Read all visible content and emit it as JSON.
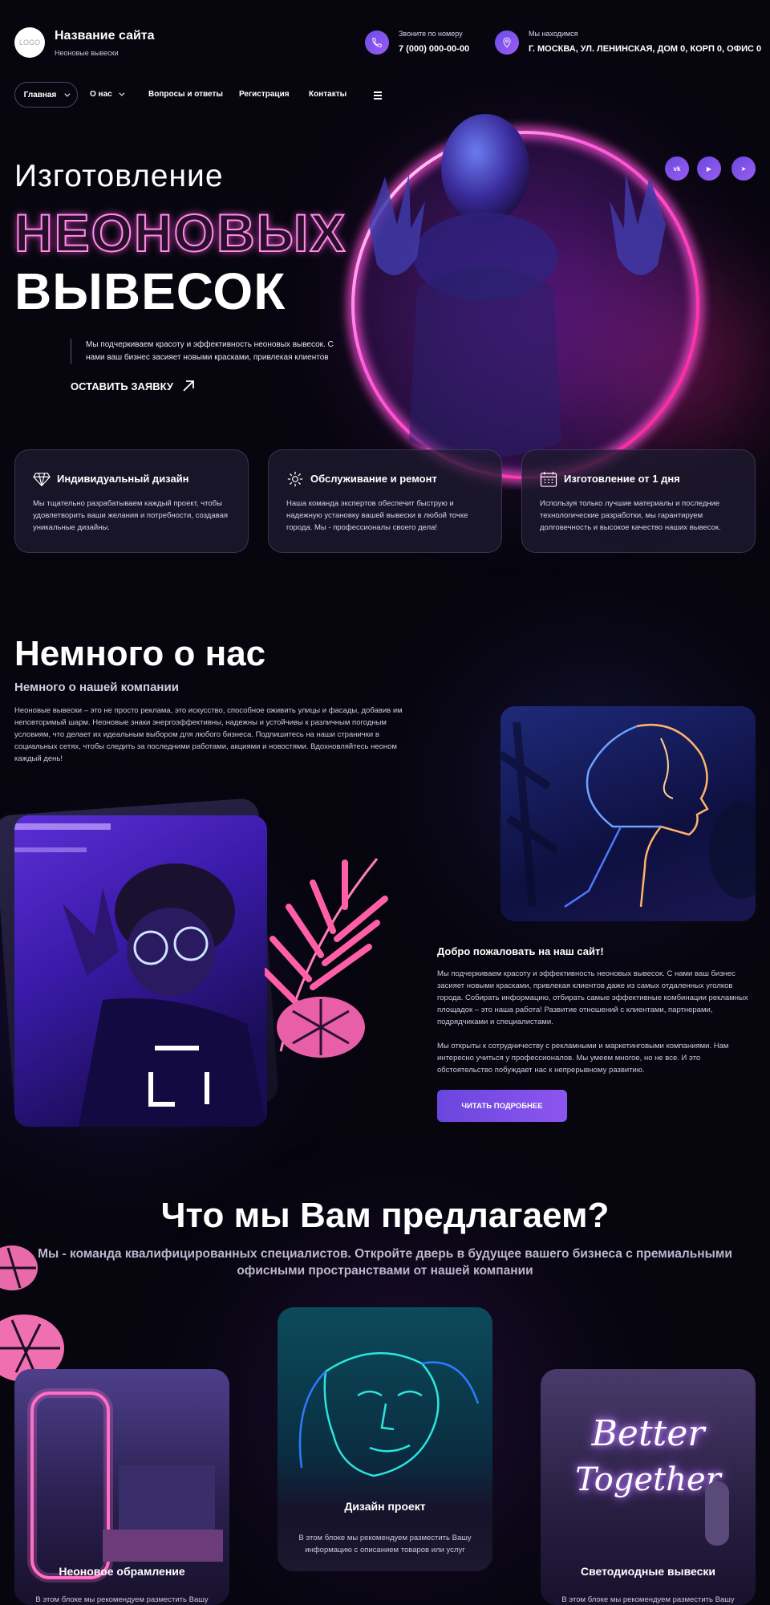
{
  "header": {
    "logo_text": "LOGO",
    "site_title": "Название сайта",
    "site_subtitle": "Неоновые вывески",
    "phone_label": "Звоните по номеру",
    "phone_value": "7 (000) 000-00-00",
    "address_label": "Мы находимся",
    "address_value": "Г. МОСКВА, УЛ. ЛЕНИНСКАЯ, ДОМ 0, КОРП 0, ОФИС 0"
  },
  "nav": {
    "items": [
      "Главная",
      "О нас",
      "Вопросы и ответы",
      "Регистрация",
      "Контакты"
    ]
  },
  "hero": {
    "line1": "Изготовление",
    "line2": "НЕОНОВЫХ",
    "line3": "ВЫВЕСОК",
    "description": "Мы подчеркиваем красоту и эффективность неоновых вывесок. С нами ваш бизнес засияет новыми красками, привлекая клиентов",
    "cta": "ОСТАВИТЬ ЗАЯВКУ"
  },
  "social": [
    "vk",
    "▶",
    "➤"
  ],
  "features": [
    {
      "title": "Индивидуальный дизайн",
      "text": "Мы тщательно разрабатываем каждый проект, чтобы удовлетворить ваши желания и потребности, создавая уникальные дизайны.",
      "icon": "diamond-icon"
    },
    {
      "title": "Обслуживание и ремонт",
      "text": "Наша команда экспертов обеспечит быструю и надежную установку вашей вывески в любой точке города. Мы - профессионалы своего дела!",
      "icon": "gear-icon"
    },
    {
      "title": "Изготовление от 1 дня",
      "text": "Используя только лучшие материалы и последние технологические разработки, мы гарантируем долговечность и высокое качество наших вывесок.",
      "icon": "calendar-icon"
    }
  ],
  "about": {
    "title": "Немного о нас",
    "subtitle": "Немного о нашей компании",
    "text": "Неоновые вывески – это не просто реклама, это искусство, способное оживить улицы и фасады, добавив им неповторимый шарм. Неоновые знаки энергоэффективны, надежны и устойчивы к различным погодным условиям, что делает их идеальным выбором для любого бизнеса. Подпишитесь на наши странички в социальных сетях, чтобы следить за последними работами, акциями и новостями. Вдохновляйтесь неоном каждый день!",
    "welcome_title": "Добро пожаловать на наш сайт!",
    "welcome_p1": "Мы подчеркиваем красоту и эффективность неоновых вывесок. С нами ваш бизнес засияет новыми красками, привлекая клиентов даже из самых отдаленных уголков города. Собирать информацию, отбирать самые эффективные комбинации рекламных площадок – это наша работа! Развитие отношений с клиентами, партнерами, подрядчиками и специалистами.",
    "welcome_p2": "Мы открыты к сотрудничеству с рекламными и маркетинговыми компаниями. Нам интересно учиться у профессионалов. Мы умеем многое, но не все. И это обстоятельство побуждает нас к непрерывному развитию.",
    "button": "ЧИТАТЬ ПОДРОБНЕЕ"
  },
  "offer": {
    "title": "Что мы Вам предлагаем?",
    "subtitle": "Мы - команда квалифицированных специалистов. Откройте дверь в будущее вашего бизнеса с премиальными офисными пространствами от нашей компании",
    "services": [
      {
        "title": "Неоновое обрамление",
        "text": "В этом блоке мы рекомендуем разместить Вашу"
      },
      {
        "title": "Дизайн проект",
        "text": "В этом блоке мы рекомендуем разместить Вашу информацию с описанием товаров или услуг"
      },
      {
        "title": "Светодиодные вывески",
        "text": "В этом блоке мы рекомендуем разместить Вашу"
      }
    ],
    "neon_sign_line1": "Better",
    "neon_sign_line2": "Together"
  }
}
